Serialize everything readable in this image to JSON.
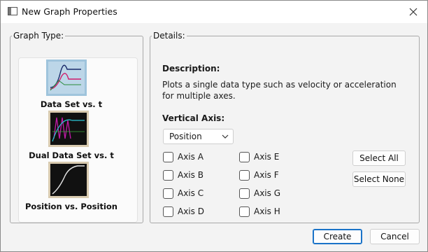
{
  "window": {
    "title": "New Graph Properties"
  },
  "graph_type": {
    "legend": "Graph Type:",
    "items": [
      {
        "label": "Data Set vs. t",
        "icon": "data-set-vs-t-thumbnail"
      },
      {
        "label": "Dual Data Set vs. t",
        "icon": "dual-data-set-vs-t-thumbnail"
      },
      {
        "label": "Position vs. Position",
        "icon": "position-vs-position-thumbnail"
      }
    ]
  },
  "details": {
    "legend": "Details:",
    "description_heading": "Description:",
    "description_text": "Plots a single data type such as velocity or acceleration for multiple axes.",
    "vertical_axis_heading": "Vertical Axis:",
    "vertical_axis_value": "Position",
    "axes_left": [
      "Axis A",
      "Axis B",
      "Axis C",
      "Axis D"
    ],
    "axes_right": [
      "Axis E",
      "Axis F",
      "Axis G",
      "Axis H"
    ],
    "select_all": "Select All",
    "select_none": "Select None"
  },
  "footer": {
    "create": "Create",
    "cancel": "Cancel"
  },
  "colors": {
    "accent": "#1a73c8",
    "window_bg": "#f3f3f3"
  }
}
